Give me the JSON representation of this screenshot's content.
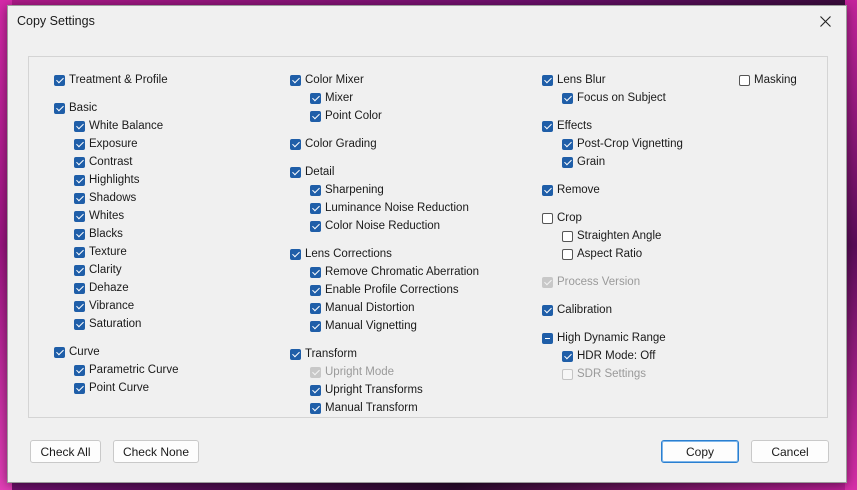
{
  "window": {
    "title": "Copy Settings"
  },
  "columns": [
    [
      {
        "label": "Treatment & Profile",
        "state": "checked",
        "level": 0
      },
      {
        "gap": true
      },
      {
        "label": "Basic",
        "state": "checked",
        "level": 0
      },
      {
        "label": "White Balance",
        "state": "checked",
        "level": 1
      },
      {
        "label": "Exposure",
        "state": "checked",
        "level": 1
      },
      {
        "label": "Contrast",
        "state": "checked",
        "level": 1
      },
      {
        "label": "Highlights",
        "state": "checked",
        "level": 1
      },
      {
        "label": "Shadows",
        "state": "checked",
        "level": 1
      },
      {
        "label": "Whites",
        "state": "checked",
        "level": 1
      },
      {
        "label": "Blacks",
        "state": "checked",
        "level": 1
      },
      {
        "label": "Texture",
        "state": "checked",
        "level": 1
      },
      {
        "label": "Clarity",
        "state": "checked",
        "level": 1
      },
      {
        "label": "Dehaze",
        "state": "checked",
        "level": 1
      },
      {
        "label": "Vibrance",
        "state": "checked",
        "level": 1
      },
      {
        "label": "Saturation",
        "state": "checked",
        "level": 1
      },
      {
        "gap": true
      },
      {
        "label": "Curve",
        "state": "checked",
        "level": 0
      },
      {
        "label": "Parametric Curve",
        "state": "checked",
        "level": 1
      },
      {
        "label": "Point Curve",
        "state": "checked",
        "level": 1
      }
    ],
    [
      {
        "label": "Color Mixer",
        "state": "checked",
        "level": 0
      },
      {
        "label": "Mixer",
        "state": "checked",
        "level": 1
      },
      {
        "label": "Point Color",
        "state": "checked",
        "level": 1
      },
      {
        "gap": true
      },
      {
        "label": "Color Grading",
        "state": "checked",
        "level": 0
      },
      {
        "gap": true
      },
      {
        "label": "Detail",
        "state": "checked",
        "level": 0
      },
      {
        "label": "Sharpening",
        "state": "checked",
        "level": 1
      },
      {
        "label": "Luminance Noise Reduction",
        "state": "checked",
        "level": 1
      },
      {
        "label": "Color Noise Reduction",
        "state": "checked",
        "level": 1
      },
      {
        "gap": true
      },
      {
        "label": "Lens Corrections",
        "state": "checked",
        "level": 0
      },
      {
        "label": "Remove Chromatic Aberration",
        "state": "checked",
        "level": 1
      },
      {
        "label": "Enable Profile Corrections",
        "state": "checked",
        "level": 1
      },
      {
        "label": "Manual Distortion",
        "state": "checked",
        "level": 1
      },
      {
        "label": "Manual Vignetting",
        "state": "checked",
        "level": 1
      },
      {
        "gap": true
      },
      {
        "label": "Transform",
        "state": "checked",
        "level": 0
      },
      {
        "label": "Upright Mode",
        "state": "disabled-checked",
        "level": 1
      },
      {
        "label": "Upright Transforms",
        "state": "checked",
        "level": 1
      },
      {
        "label": "Manual Transform",
        "state": "checked",
        "level": 1
      }
    ],
    [
      {
        "label": "Lens Blur",
        "state": "checked",
        "level": 0
      },
      {
        "label": "Focus on Subject",
        "state": "checked",
        "level": 1
      },
      {
        "gap": true
      },
      {
        "label": "Effects",
        "state": "checked",
        "level": 0
      },
      {
        "label": "Post-Crop Vignetting",
        "state": "checked",
        "level": 1
      },
      {
        "label": "Grain",
        "state": "checked",
        "level": 1
      },
      {
        "gap": true
      },
      {
        "label": "Remove",
        "state": "checked",
        "level": 0
      },
      {
        "gap": true
      },
      {
        "label": "Crop",
        "state": "unchecked",
        "level": 0
      },
      {
        "label": "Straighten Angle",
        "state": "unchecked",
        "level": 1
      },
      {
        "label": "Aspect Ratio",
        "state": "unchecked",
        "level": 1
      },
      {
        "gap": true
      },
      {
        "label": "Process Version",
        "state": "disabled-checked",
        "level": 0
      },
      {
        "gap": true
      },
      {
        "label": "Calibration",
        "state": "checked",
        "level": 0
      },
      {
        "gap": true
      },
      {
        "label": "High Dynamic Range",
        "state": "mixed",
        "level": 0
      },
      {
        "label": "HDR Mode: Off",
        "state": "checked",
        "level": 1
      },
      {
        "label": "SDR Settings",
        "state": "disabled-unchecked",
        "level": 1
      }
    ],
    [
      {
        "label": "Masking",
        "state": "unchecked",
        "level": 0
      }
    ]
  ],
  "buttons": {
    "check_all": "Check All",
    "check_none": "Check None",
    "copy": "Copy",
    "cancel": "Cancel"
  },
  "colors": {
    "accent": "#1f5ea8",
    "dialog_bg": "#f0f0f0"
  }
}
